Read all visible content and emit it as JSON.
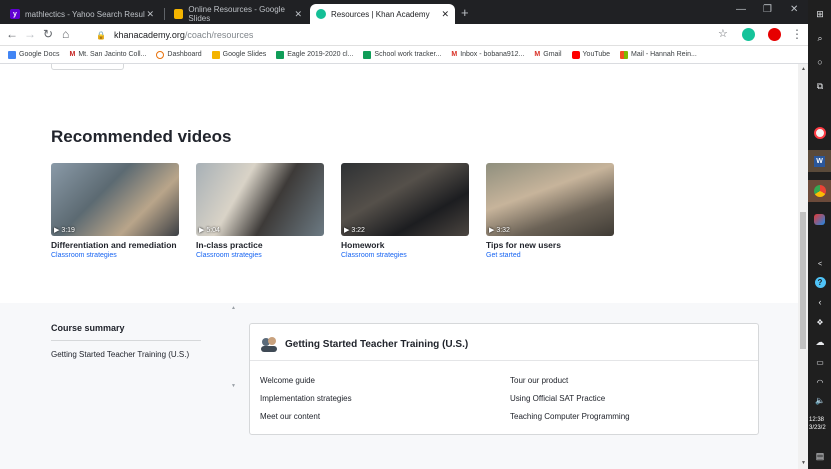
{
  "tabs": [
    {
      "title": "mathlectics - Yahoo Search Resul",
      "icon": "yahoo-icon",
      "color": "#6001d2"
    },
    {
      "title": "Online Resources - Google Slides",
      "icon": "slides-icon",
      "color": "#f4b400"
    },
    {
      "title": "Resources | Khan Academy",
      "icon": "khan-icon",
      "color": "#14bf96"
    }
  ],
  "address": {
    "host": "khanacademy.org",
    "path": "/coach/resources"
  },
  "bookmarks": [
    {
      "label": "Google Docs",
      "color": "#4285f4"
    },
    {
      "label": "Mt. San Jacinto Coll...",
      "color": "#c5221f"
    },
    {
      "label": "Dashboard",
      "color": "#e8710a"
    },
    {
      "label": "Google Slides",
      "color": "#f4b400"
    },
    {
      "label": "Eagle 2019-2020 cl...",
      "color": "#0f9d58"
    },
    {
      "label": "School work tracker...",
      "color": "#0f9d58"
    },
    {
      "label": "Inbox - bobana912...",
      "color": "#d93025"
    },
    {
      "label": "Gmail",
      "color": "#d93025"
    },
    {
      "label": "YouTube",
      "color": "#ff0000"
    },
    {
      "label": "Mail - Hannah Rein...",
      "color": "#f25022"
    }
  ],
  "recommended": {
    "title": "Recommended videos",
    "videos": [
      {
        "duration": "▶ 3:19",
        "title": "Differentiation and remediation",
        "category": "Classroom strategies"
      },
      {
        "duration": "▶ 5:04",
        "title": "In-class practice",
        "category": "Classroom strategies"
      },
      {
        "duration": "▶ 3:22",
        "title": "Homework",
        "category": "Classroom strategies"
      },
      {
        "duration": "▶ 3:32",
        "title": "Tips for new users",
        "category": "Get started"
      }
    ]
  },
  "summary": {
    "title": "Course summary",
    "item": "Getting Started Teacher Training (U.S.)"
  },
  "course_card": {
    "title": "Getting Started Teacher Training (U.S.)",
    "links_left": [
      "Welcome guide",
      "Implementation strategies",
      "Meet our content"
    ],
    "links_right": [
      "Tour our product",
      "Using Official SAT Practice",
      "Teaching Computer Programming"
    ]
  },
  "clock": {
    "time": "12:38",
    "date": "3/23/2"
  }
}
